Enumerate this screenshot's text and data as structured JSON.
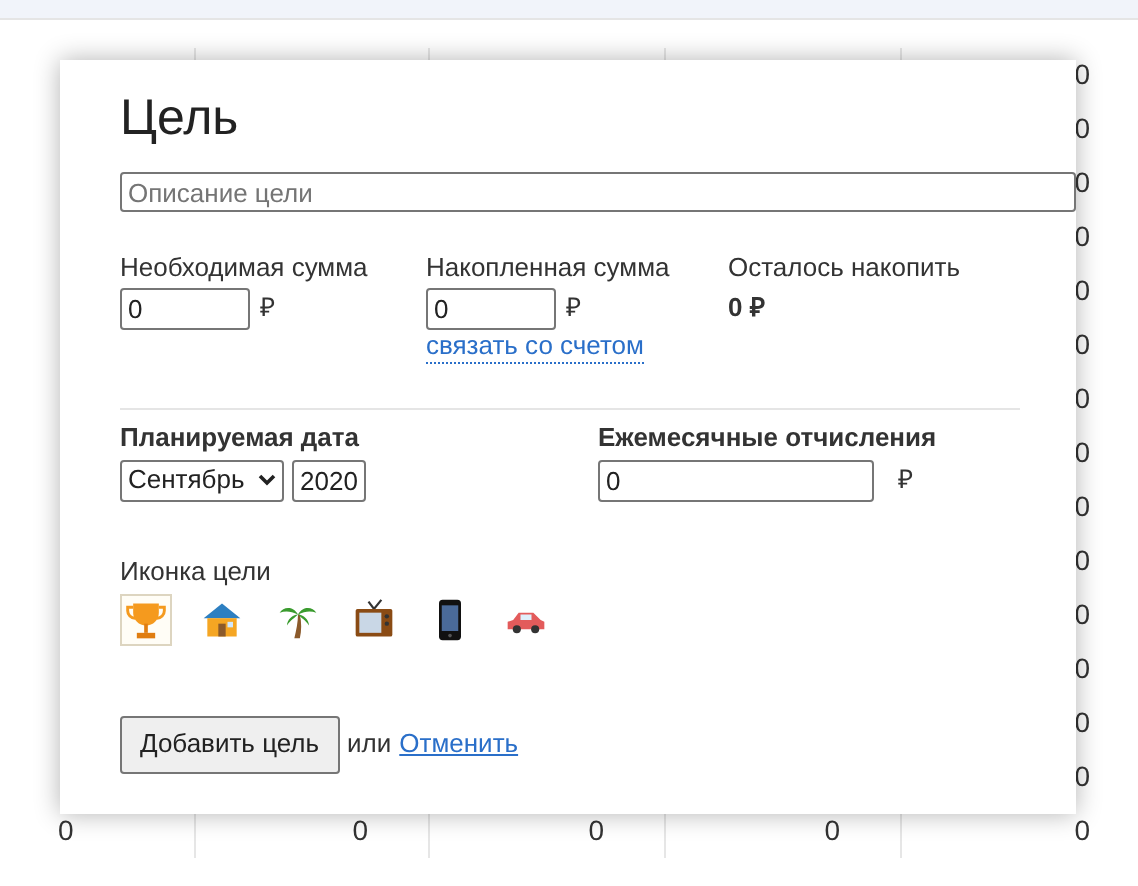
{
  "background_table": {
    "rows": [
      {
        "column_5": "0"
      },
      {
        "column_5": "0"
      },
      {
        "column_5": "0"
      },
      {
        "column_5": "0"
      },
      {
        "column_5": "0"
      },
      {
        "column_5": "0"
      },
      {
        "column_5": "0"
      },
      {
        "column_5": "0"
      },
      {
        "column_5": "0"
      },
      {
        "column_5": "0"
      },
      {
        "column_5": "0"
      },
      {
        "column_5": "0"
      },
      {
        "column_5": "0"
      },
      {
        "column_5": "0"
      },
      {
        "column_1": "0",
        "column_2": "0",
        "column_3": "0",
        "column_4": "0",
        "column_5": "0"
      }
    ]
  },
  "dialog": {
    "title": "Цель",
    "description": {
      "placeholder": "Описание цели"
    },
    "amounts": [
      {
        "kind": "input",
        "label": "Необходимая сумма",
        "value": "0",
        "currency": "₽"
      },
      {
        "kind": "input",
        "label": "Накопленная сумма",
        "value": "0",
        "currency": "₽",
        "link": "связать со счетом"
      },
      {
        "kind": "readout",
        "label": "Осталось накопить",
        "value": "0 ₽"
      }
    ],
    "planned_date": {
      "label": "Планируемая дата",
      "month": "Сентябрь",
      "year": "2020"
    },
    "monthly": {
      "label": "Ежемесячные отчисления",
      "value": "0",
      "currency": "₽"
    },
    "icons": {
      "label": "Иконка цели",
      "items": [
        {
          "kind": "trophy",
          "selected": true
        },
        {
          "kind": "house",
          "selected": false
        },
        {
          "kind": "palm",
          "selected": false
        },
        {
          "kind": "tv",
          "selected": false
        },
        {
          "kind": "phone",
          "selected": false
        },
        {
          "kind": "car",
          "selected": false
        }
      ]
    },
    "footer": {
      "submit": "Добавить цель",
      "separator": "или",
      "cancel": "Отменить"
    }
  }
}
